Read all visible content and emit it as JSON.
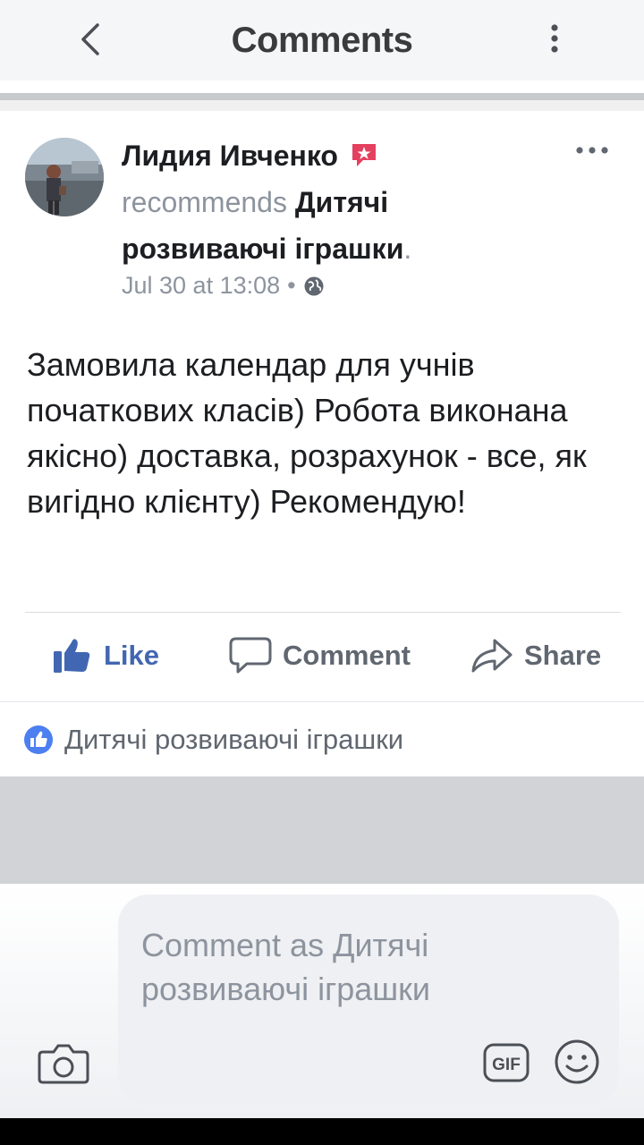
{
  "header": {
    "title": "Comments"
  },
  "post": {
    "author": "Лидия Ивченко",
    "action_text": "recommends",
    "page": "Дитячі розвиваючі іграшки",
    "period": ".",
    "timestamp": "Jul 30 at 13:08",
    "meta_separator": "•",
    "privacy_icon": "globe-icon",
    "text": "Замовила календар для учнів початкових класів) Робота виконана якісно) доставка, розрахунок - все, як вигідно клієнту) Рекомендую!"
  },
  "actions": {
    "like": "Like",
    "comment": "Comment",
    "share": "Share"
  },
  "liked_by": {
    "label": "Дитячі розвиваючі іграшки"
  },
  "composer": {
    "placeholder": "Comment as Дитячі розвиваючі іграшки"
  },
  "colors": {
    "accent": "#4267b2",
    "badge": "#e4405f",
    "muted_text": "#8d949e"
  }
}
